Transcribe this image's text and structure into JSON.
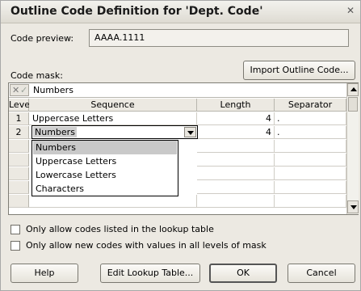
{
  "dialog": {
    "title": "Outline Code Definition for 'Dept. Code'",
    "close_glyph": "✕"
  },
  "code_preview": {
    "label": "Code preview:",
    "value": "AAAA.1111"
  },
  "import_button": "Import Outline Code...",
  "code_mask": {
    "label": "Code mask:",
    "edit_value": "Numbers",
    "columns": [
      "Level",
      "Sequence",
      "Length",
      "Separator"
    ],
    "rows": [
      {
        "level": "1",
        "sequence": "Uppercase Letters",
        "length": "4",
        "separator": "."
      },
      {
        "level": "2",
        "sequence": "Numbers",
        "length": "4",
        "separator": "."
      }
    ],
    "dropdown_options": [
      "Numbers",
      "Uppercase Letters",
      "Lowercase Letters",
      "Characters"
    ],
    "selected_option": "Numbers"
  },
  "checkboxes": [
    {
      "label": "Only allow codes listed in the lookup table",
      "checked": false
    },
    {
      "label": "Only allow new codes with values in all levels of mask",
      "checked": false
    }
  ],
  "buttons": {
    "help": "Help",
    "edit_lookup": "Edit Lookup Table...",
    "ok": "OK",
    "cancel": "Cancel"
  },
  "icons": [
    "close-icon",
    "cancel-edit-icon",
    "accept-edit-icon",
    "dropdown-arrow-icon",
    "scroll-up-icon",
    "scroll-down-icon"
  ]
}
